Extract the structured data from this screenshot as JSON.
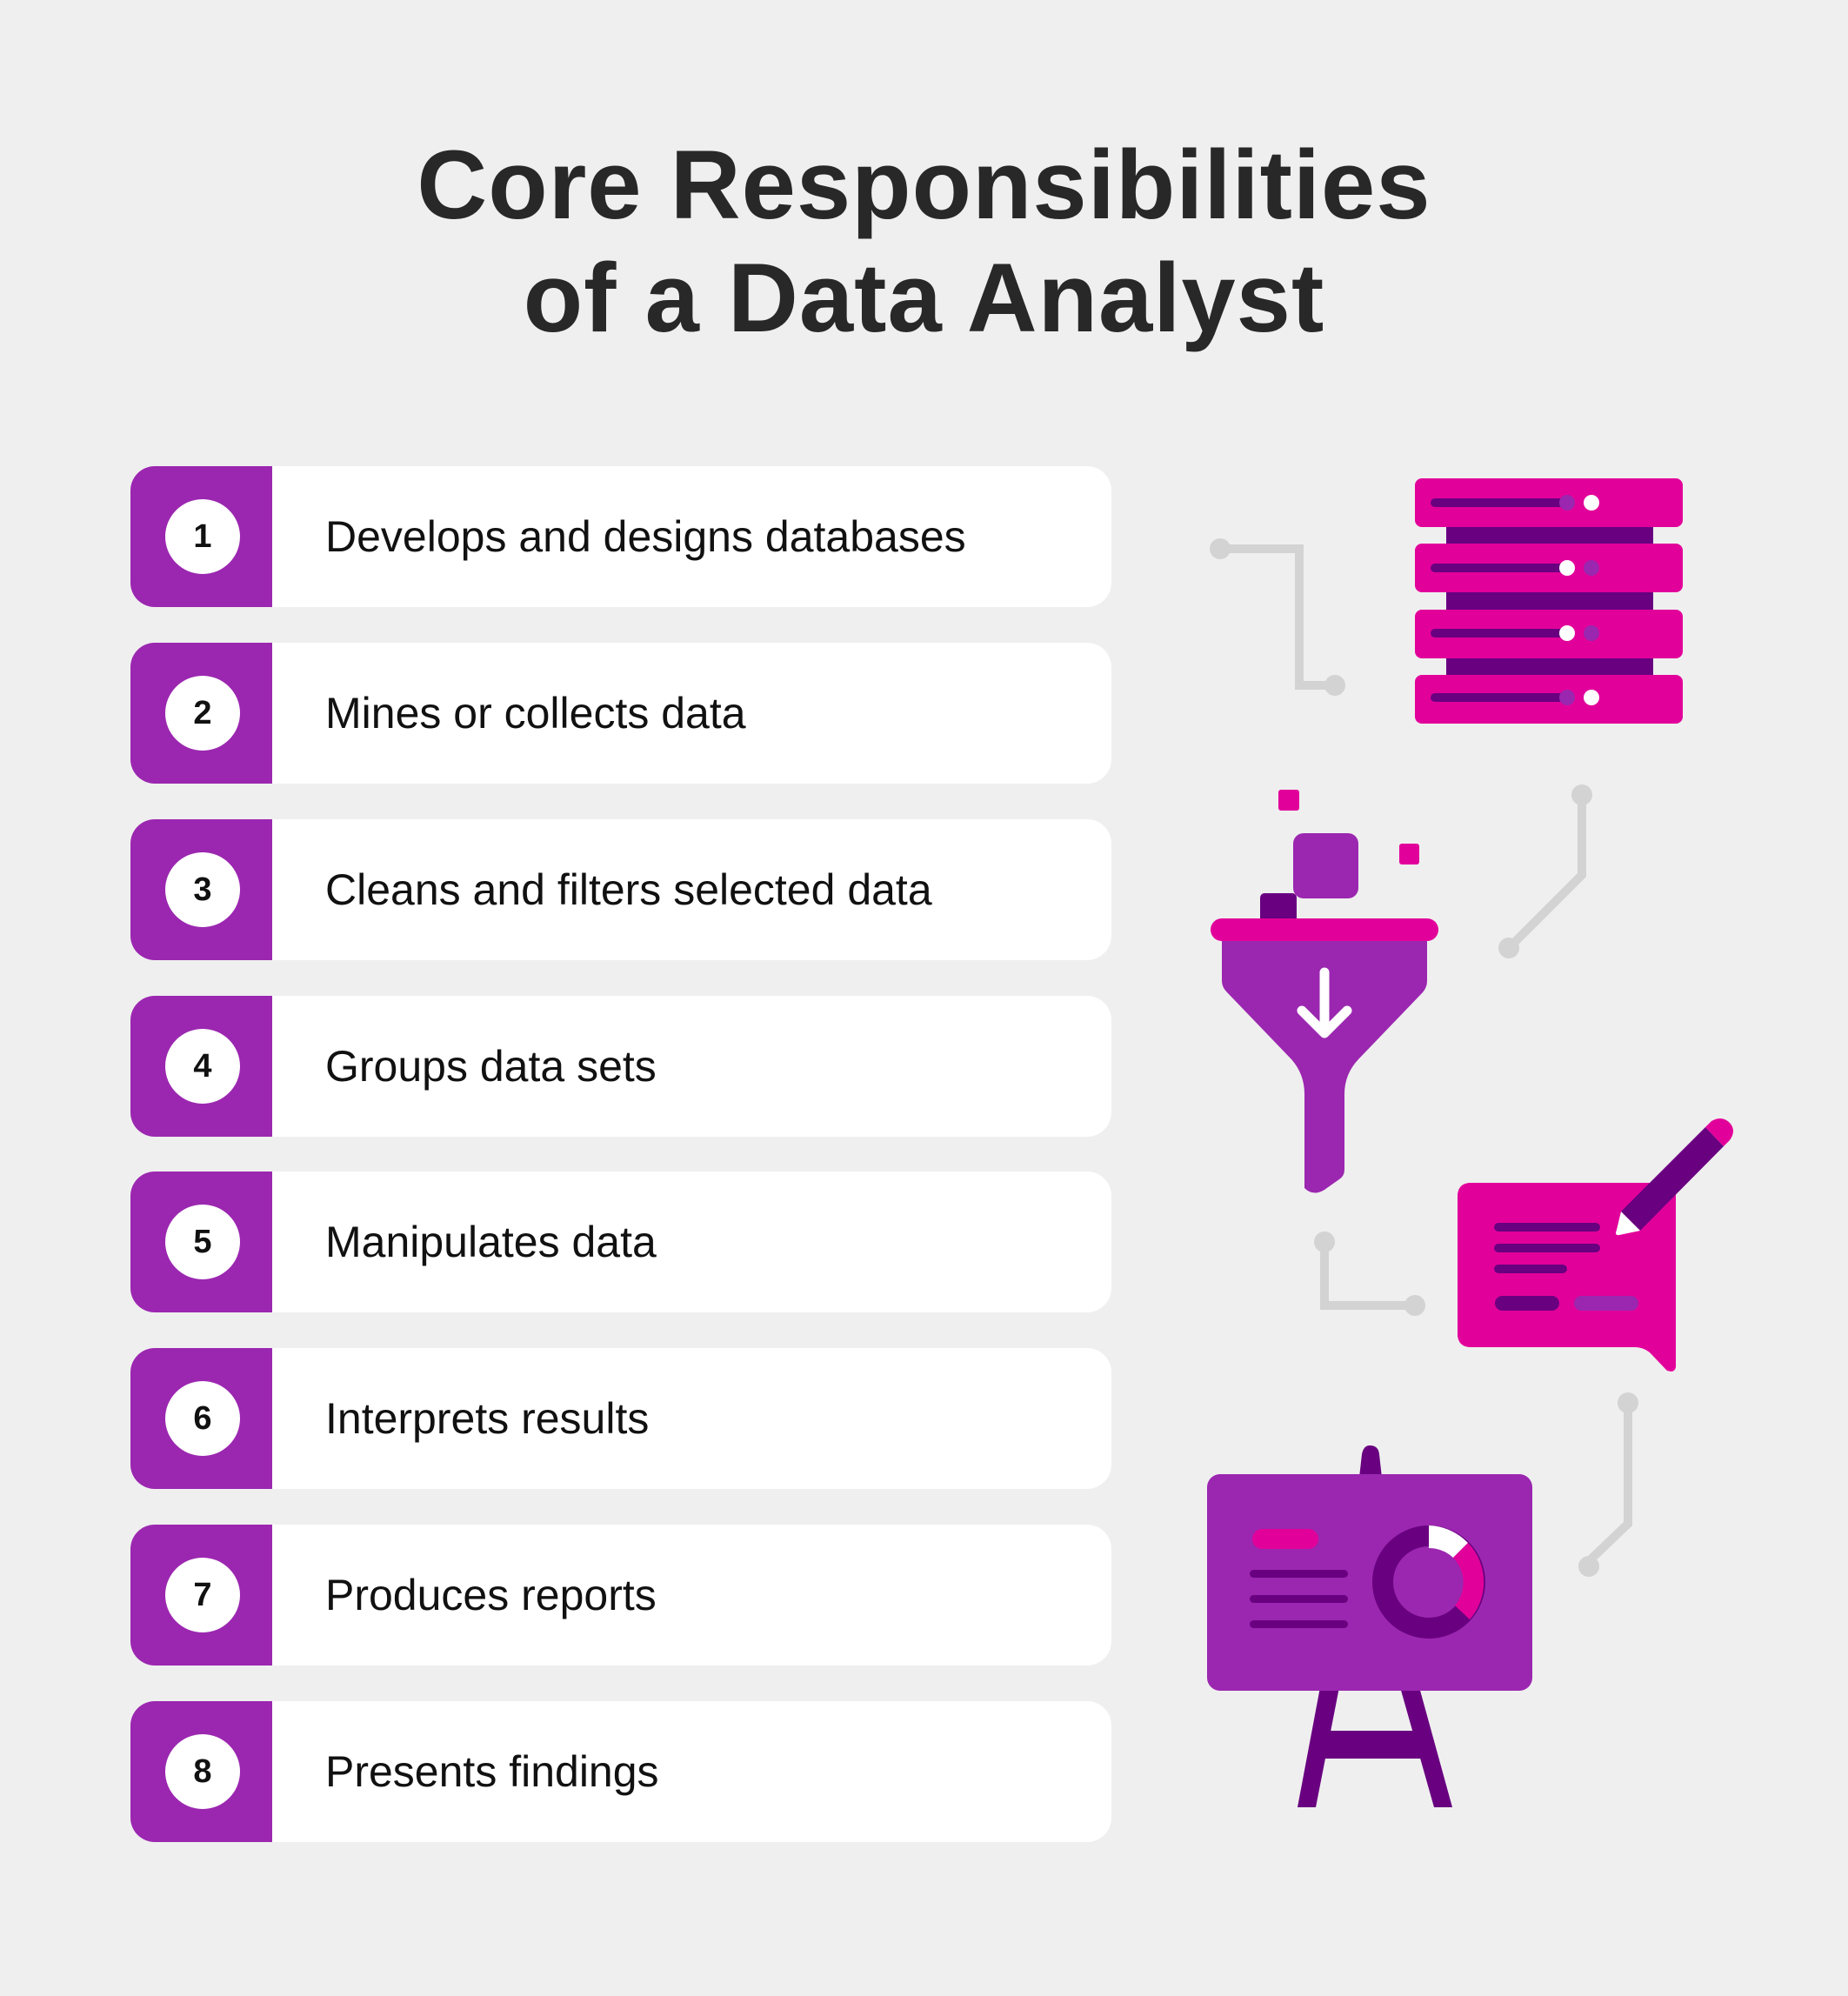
{
  "title": {
    "line1": "Core Responsibilities",
    "line2": "of a Data Analyst"
  },
  "responsibilities": [
    {
      "number": "1",
      "label": "Develops and designs databases"
    },
    {
      "number": "2",
      "label": "Mines or collects data"
    },
    {
      "number": "3",
      "label": "Cleans and filters selected data"
    },
    {
      "number": "4",
      "label": "Groups data sets"
    },
    {
      "number": "5",
      "label": "Manipulates data"
    },
    {
      "number": "6",
      "label": "Interprets results"
    },
    {
      "number": "7",
      "label": "Produces reports"
    },
    {
      "number": "8",
      "label": "Presents findings"
    }
  ],
  "illustrations": [
    {
      "icon": "database-server-icon"
    },
    {
      "icon": "funnel-filter-icon"
    },
    {
      "icon": "speech-bubble-pencil-icon"
    },
    {
      "icon": "presentation-board-icon"
    }
  ],
  "colors": {
    "background": "#efefef",
    "purple": "#9b27b0",
    "magenta": "#e2009a",
    "dark_purple": "#690080",
    "connector_gray": "#d3d3d3",
    "title_text": "#282828"
  }
}
